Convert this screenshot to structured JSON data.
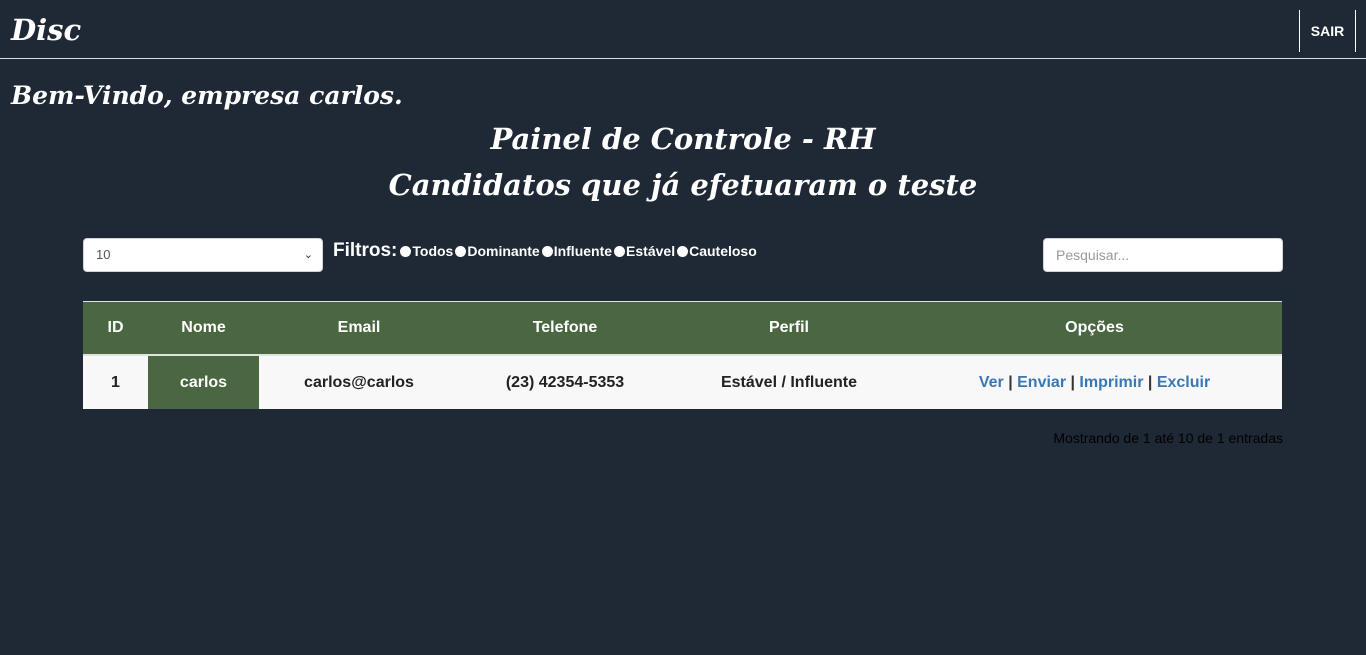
{
  "navbar": {
    "brand": "Disc",
    "logout_label": "SAIR"
  },
  "welcome": "Bem-Vindo, empresa carlos.",
  "heading": {
    "title": "Painel de Controle - RH",
    "subtitle": "Candidatos que já efetuaram o teste"
  },
  "controls": {
    "page_size": "10",
    "filters_label": "Filtros:",
    "filters": [
      "Todos",
      "Dominante",
      "Influente",
      "Estável",
      "Cauteloso"
    ],
    "search_placeholder": "Pesquisar..."
  },
  "table": {
    "headers": [
      "ID",
      "Nome",
      "Email",
      "Telefone",
      "Perfil",
      "Opções"
    ],
    "rows": [
      {
        "id": "1",
        "name": "carlos",
        "email": "carlos@carlos",
        "phone": "(23) 42354-5353",
        "profile": "Estável / Influente",
        "actions": [
          "Ver",
          "Enviar",
          "Imprimir",
          "Excluir"
        ]
      }
    ]
  },
  "footer_info": "Mostrando de 1 até 10 de 1 entradas",
  "colors": {
    "background": "#1f2835",
    "header_green": "#4a6742",
    "link_blue": "#3978b5"
  }
}
